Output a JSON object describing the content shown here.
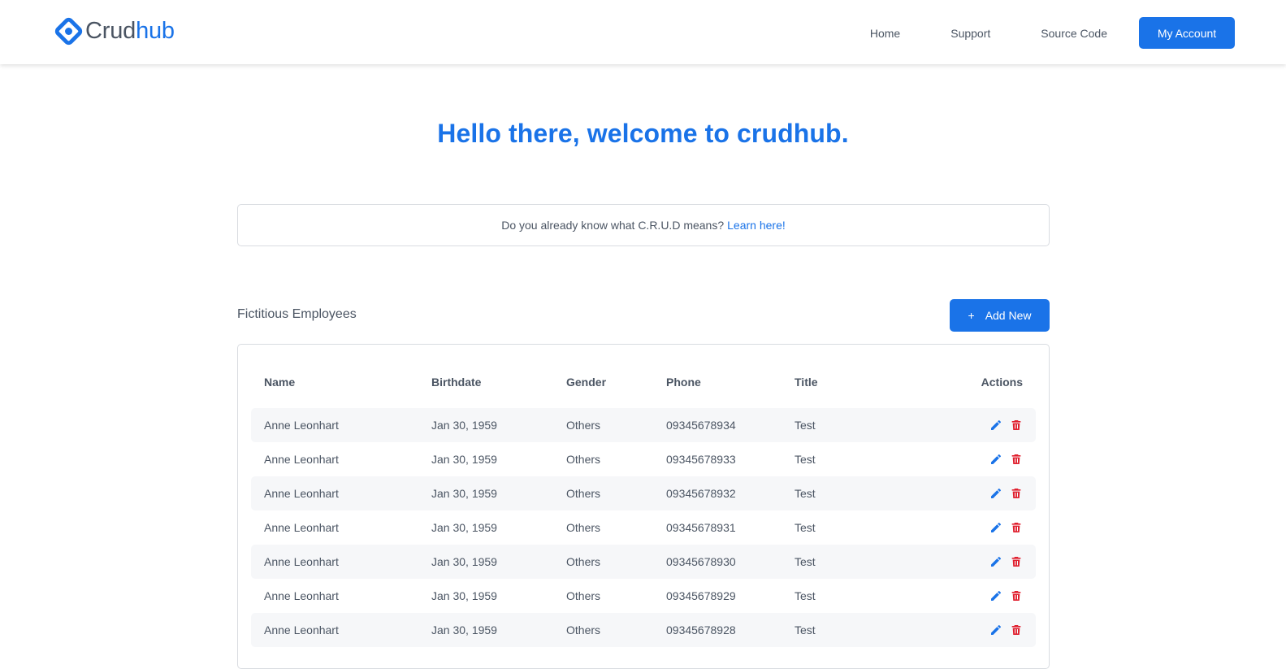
{
  "brand": {
    "part1": "Crud",
    "part2": "hub",
    "colors": {
      "primary": "#1a73e8",
      "text": "#4b5563",
      "danger": "#e0202f"
    }
  },
  "nav": {
    "links": [
      "Home",
      "Support",
      "Source Code"
    ],
    "account_label": "My Account"
  },
  "hero": {
    "title": "Hello there, welcome to crudhub."
  },
  "info": {
    "text": "Do you already know what C.R.U.D means?",
    "link": "Learn here!"
  },
  "employees": {
    "section_title": "Fictitious Employees",
    "add_label": "Add New",
    "add_icon": "+",
    "columns": [
      "Name",
      "Birthdate",
      "Gender",
      "Phone",
      "Title",
      "Actions"
    ],
    "rows": [
      [
        "Anne Leonhart",
        "Jan 30, 1959",
        "Others",
        "09345678934",
        "Test"
      ],
      [
        "Anne Leonhart",
        "Jan 30, 1959",
        "Others",
        "09345678933",
        "Test"
      ],
      [
        "Anne Leonhart",
        "Jan 30, 1959",
        "Others",
        "09345678932",
        "Test"
      ],
      [
        "Anne Leonhart",
        "Jan 30, 1959",
        "Others",
        "09345678931",
        "Test"
      ],
      [
        "Anne Leonhart",
        "Jan 30, 1959",
        "Others",
        "09345678930",
        "Test"
      ],
      [
        "Anne Leonhart",
        "Jan 30, 1959",
        "Others",
        "09345678929",
        "Test"
      ],
      [
        "Anne Leonhart",
        "Jan 30, 1959",
        "Others",
        "09345678928",
        "Test"
      ]
    ],
    "row_icons": [
      "pencil-icon",
      "trash-icon"
    ]
  }
}
